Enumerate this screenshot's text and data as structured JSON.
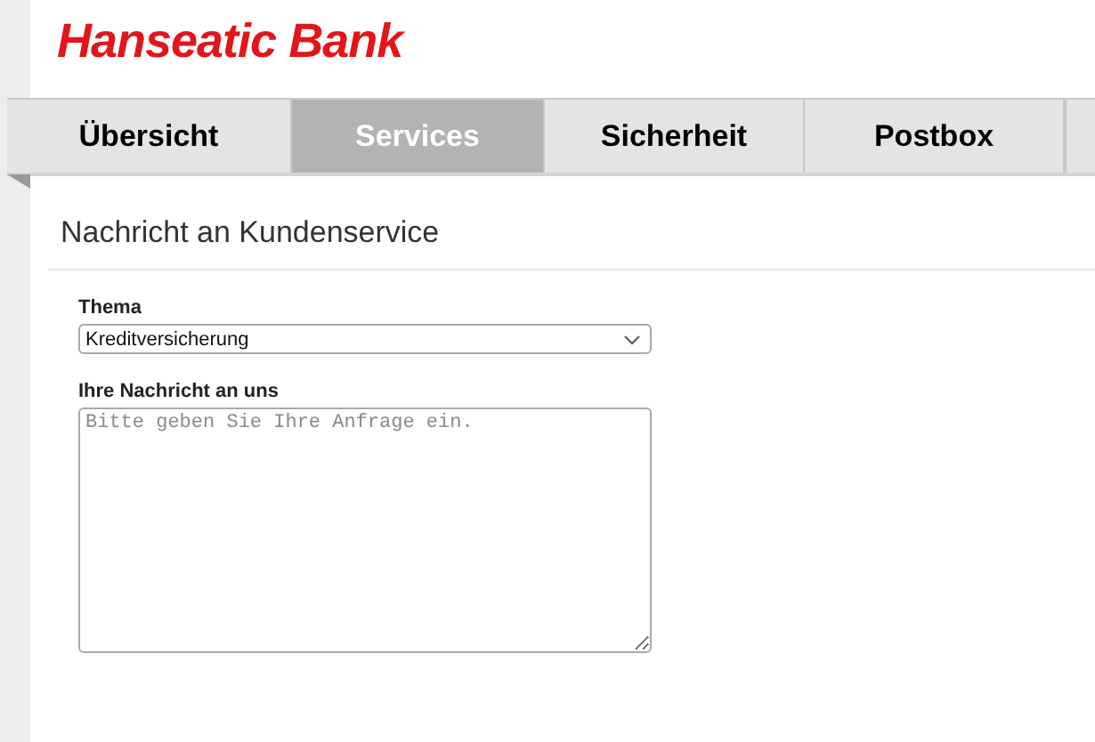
{
  "logo": {
    "text": "Hanseatic Bank"
  },
  "tabs": [
    {
      "label": "Übersicht",
      "selected": false
    },
    {
      "label": "Services",
      "selected": true
    },
    {
      "label": "Sicherheit",
      "selected": false
    },
    {
      "label": "Postbox",
      "selected": false
    }
  ],
  "heading": "Nachricht an Kundenservice",
  "form": {
    "topic": {
      "label": "Thema",
      "value": "Kreditversicherung"
    },
    "message": {
      "label": "Ihre Nachricht an uns",
      "placeholder": "Bitte geben Sie Ihre Anfrage ein."
    }
  }
}
